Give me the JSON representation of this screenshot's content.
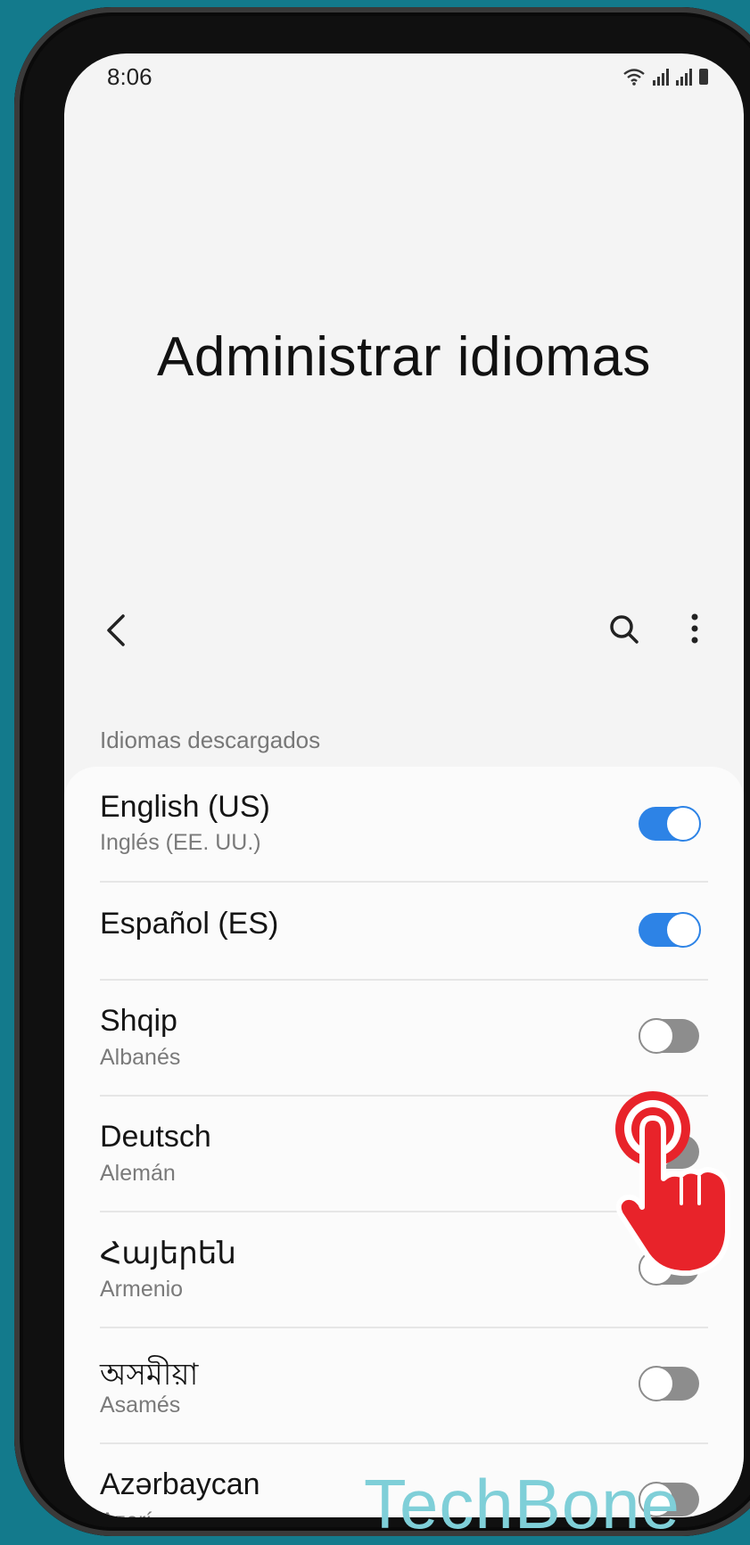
{
  "status_bar": {
    "time": "8:06"
  },
  "page": {
    "title": "Administrar idiomas"
  },
  "toolbar": {
    "back_icon": "chevron-left-icon",
    "search_icon": "search-icon",
    "more_icon": "more-vertical-icon"
  },
  "section": {
    "label": "Idiomas descargados"
  },
  "languages": [
    {
      "name": "English (US)",
      "subtitle": "Inglés (EE. UU.)",
      "enabled": true
    },
    {
      "name": "Español (ES)",
      "subtitle": "",
      "enabled": true
    },
    {
      "name": "Shqip",
      "subtitle": "Albanés",
      "enabled": false
    },
    {
      "name": "Deutsch",
      "subtitle": "Alemán",
      "enabled": false
    },
    {
      "name": "Հայերեն",
      "subtitle": "Armenio",
      "enabled": false
    },
    {
      "name": "অসমীয়া",
      "subtitle": "Asamés",
      "enabled": false
    },
    {
      "name": "Azərbaycan",
      "subtitle": "Azerí",
      "enabled": false
    }
  ],
  "colors": {
    "accent": "#2d83e6",
    "background": "#137a8c",
    "watermark": "#7fcfd8",
    "pointer": "#e8232a"
  },
  "overlay": {
    "watermark_text": "TechBone",
    "pointer_icon": "tap-hand-icon"
  }
}
